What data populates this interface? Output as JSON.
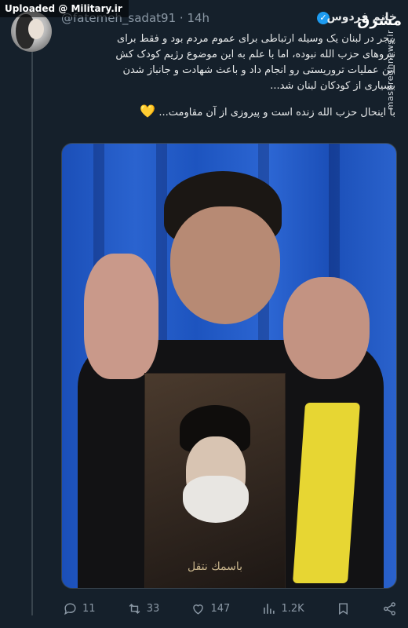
{
  "upload_banner": "Uploaded @ Military.ir",
  "tweet": {
    "display_name": "خانم فردوس",
    "username": "@fatemeh_sadat91",
    "time": "14h",
    "body_lines": [
      "پیجر در لبنان یک وسیله ارتباطی برای عموم مردم بود و فقط برای",
      "نیروهای حزب الله نبوده، اما با علم به این موضوع رژیم کودک کش",
      "این عملیات تروریستی رو انجام داد و باعث شهادت و جانباز شدن",
      "بسیاری از کودکان لبنان شد..."
    ],
    "second_line": "با اینحال حزب الله زنده است و پیروزی از آن مقاومت...",
    "heart_emoji": "💛",
    "media_poster_text": "باسمك نتقل"
  },
  "watermark": {
    "logo": "مشرق",
    "url": "mashreghnews.ir"
  },
  "actions": {
    "replies": "11",
    "retweets": "33",
    "likes": "147",
    "views": "1.2K"
  },
  "colors": {
    "background": "#15202b",
    "text": "#e7e9ea",
    "muted": "#8b98a5",
    "verified": "#1d9bf0"
  }
}
